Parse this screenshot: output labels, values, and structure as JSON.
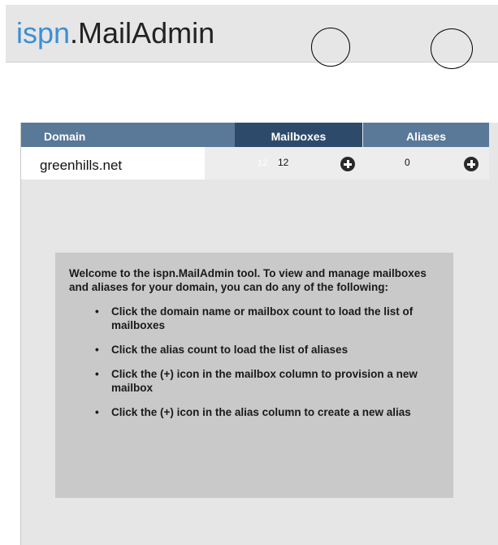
{
  "header": {
    "brand": "ispn",
    "app_name": ".MailAdmin"
  },
  "table": {
    "columns": [
      "Domain",
      "Mailboxes",
      "Aliases"
    ],
    "rows": [
      {
        "domain": "greenhills.net",
        "mailbox_ghost": "12",
        "mailboxes": "12",
        "aliases": "0"
      }
    ]
  },
  "info": {
    "intro": "Welcome to the ispn.MailAdmin tool. To view and manage mailboxes and aliases for your domain, you can do any of the following:",
    "items": [
      "Click the domain name or mailbox count to load the list of mailboxes",
      "Click the alias count to load the list of aliases",
      "Click the (+) icon in the mailbox column to provision a new mailbox",
      "Click the (+) icon in the alias column to create a new alias"
    ]
  },
  "colors": {
    "brand_blue": "#3b8fd6",
    "header_bg": "#e6e6e6",
    "col_header": "#5a7898",
    "col_header_active": "#2e4a6b",
    "info_bg": "#c9c9c9"
  },
  "icons": [
    "add-circle-icon"
  ]
}
